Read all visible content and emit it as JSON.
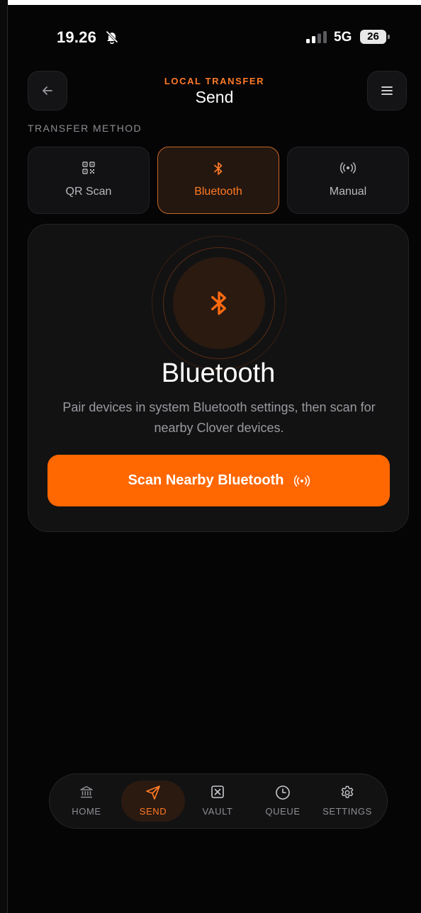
{
  "status_bar": {
    "time": "19.26",
    "network": "5G",
    "battery": "26",
    "bell_icon": "bell-slash-icon",
    "signal_icon": "cellular-signal-icon"
  },
  "header": {
    "subtitle": "LOCAL TRANSFER",
    "title": "Send",
    "back_icon": "arrow-left-icon",
    "menu_icon": "hamburger-menu-icon"
  },
  "transfer_method": {
    "label": "TRANSFER METHOD",
    "options": [
      {
        "label": "QR Scan",
        "icon": "qr-code-icon",
        "selected": false
      },
      {
        "label": "Bluetooth",
        "icon": "bluetooth-icon",
        "selected": true
      },
      {
        "label": "Manual",
        "icon": "broadcast-icon",
        "selected": false
      }
    ]
  },
  "bluetooth_card": {
    "title": "Bluetooth",
    "description": "Pair devices in system Bluetooth settings, then scan for nearby Clover devices.",
    "scan_button": "Scan Nearby Bluetooth",
    "scan_icon": "broadcast-icon"
  },
  "bottom_nav": {
    "items": [
      {
        "label": "HOME",
        "icon": "bank-icon",
        "active": false
      },
      {
        "label": "SEND",
        "icon": "send-icon",
        "active": true
      },
      {
        "label": "VAULT",
        "icon": "vault-icon",
        "active": false
      },
      {
        "label": "QUEUE",
        "icon": "clock-icon",
        "active": false
      },
      {
        "label": "SETTINGS",
        "icon": "gear-icon",
        "active": false
      }
    ]
  },
  "colors": {
    "accent": "#ff6700",
    "accent_text": "#ff7a26",
    "background": "#050506",
    "card": "#121213"
  }
}
